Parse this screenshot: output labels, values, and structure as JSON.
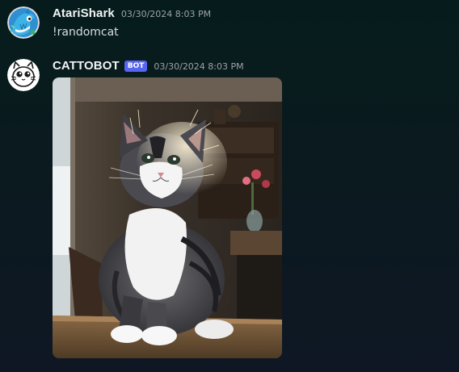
{
  "messages": [
    {
      "avatar_icon": "shark-avatar-icon",
      "username": "AtariShark",
      "timestamp": "03/30/2024 8:03 PM",
      "content": "!randomcat"
    },
    {
      "avatar_icon": "cat-face-avatar-icon",
      "username": "CATTOBOT",
      "bot_tag": "BOT",
      "timestamp": "03/30/2024 8:03 PM",
      "attachment": "kitten-photo"
    }
  ],
  "colors": {
    "bot_tag": "#5865f2",
    "username": "#f2f3f5",
    "timestamp": "#9da2a8",
    "text": "#dbdee1",
    "background": "#0a1a1e"
  }
}
